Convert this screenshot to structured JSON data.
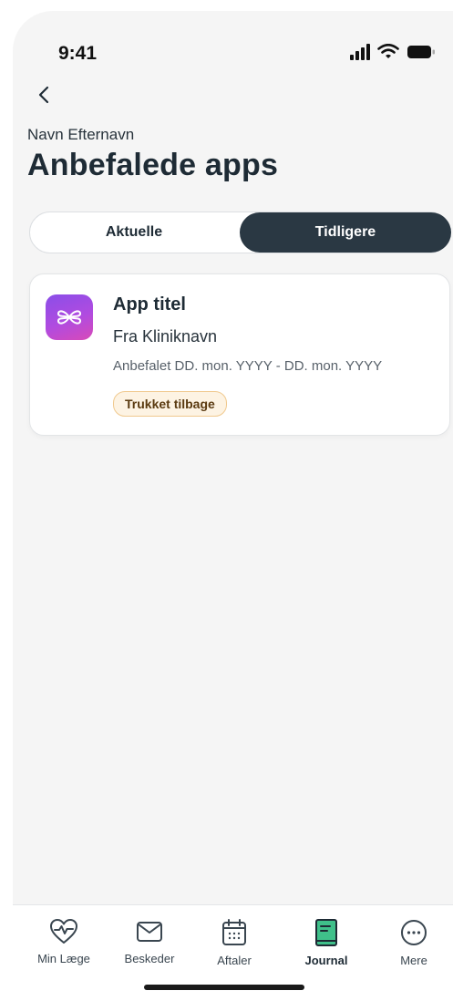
{
  "status_bar": {
    "time": "9:41"
  },
  "header": {
    "patient_name": "Navn Efternavn",
    "title": "Anbefalede apps"
  },
  "segments": {
    "items": [
      {
        "label": "Aktuelle",
        "selected": false
      },
      {
        "label": "Tidligere",
        "selected": true
      }
    ]
  },
  "recommended_app": {
    "icon": "app-logo-icon",
    "title": "App titel",
    "source": "Fra Kliniknavn",
    "dates": "Anbefalet DD. mon. YYYY - DD. mon. YYYY",
    "status": "Trukket tilbage"
  },
  "tab_bar": {
    "items": [
      {
        "label": "Min Læge",
        "icon": "heart-pulse-icon"
      },
      {
        "label": "Beskeder",
        "icon": "envelope-icon"
      },
      {
        "label": "Aftaler",
        "icon": "calendar-icon"
      },
      {
        "label": "Journal",
        "icon": "journal-book-icon",
        "active": true
      },
      {
        "label": "Mere",
        "icon": "more-dots-icon"
      }
    ]
  },
  "colors": {
    "accent_dark": "#2a3843",
    "journal_green": "#3fc08a",
    "badge_bg": "#fdf3e3",
    "badge_border": "#f0c98e"
  }
}
